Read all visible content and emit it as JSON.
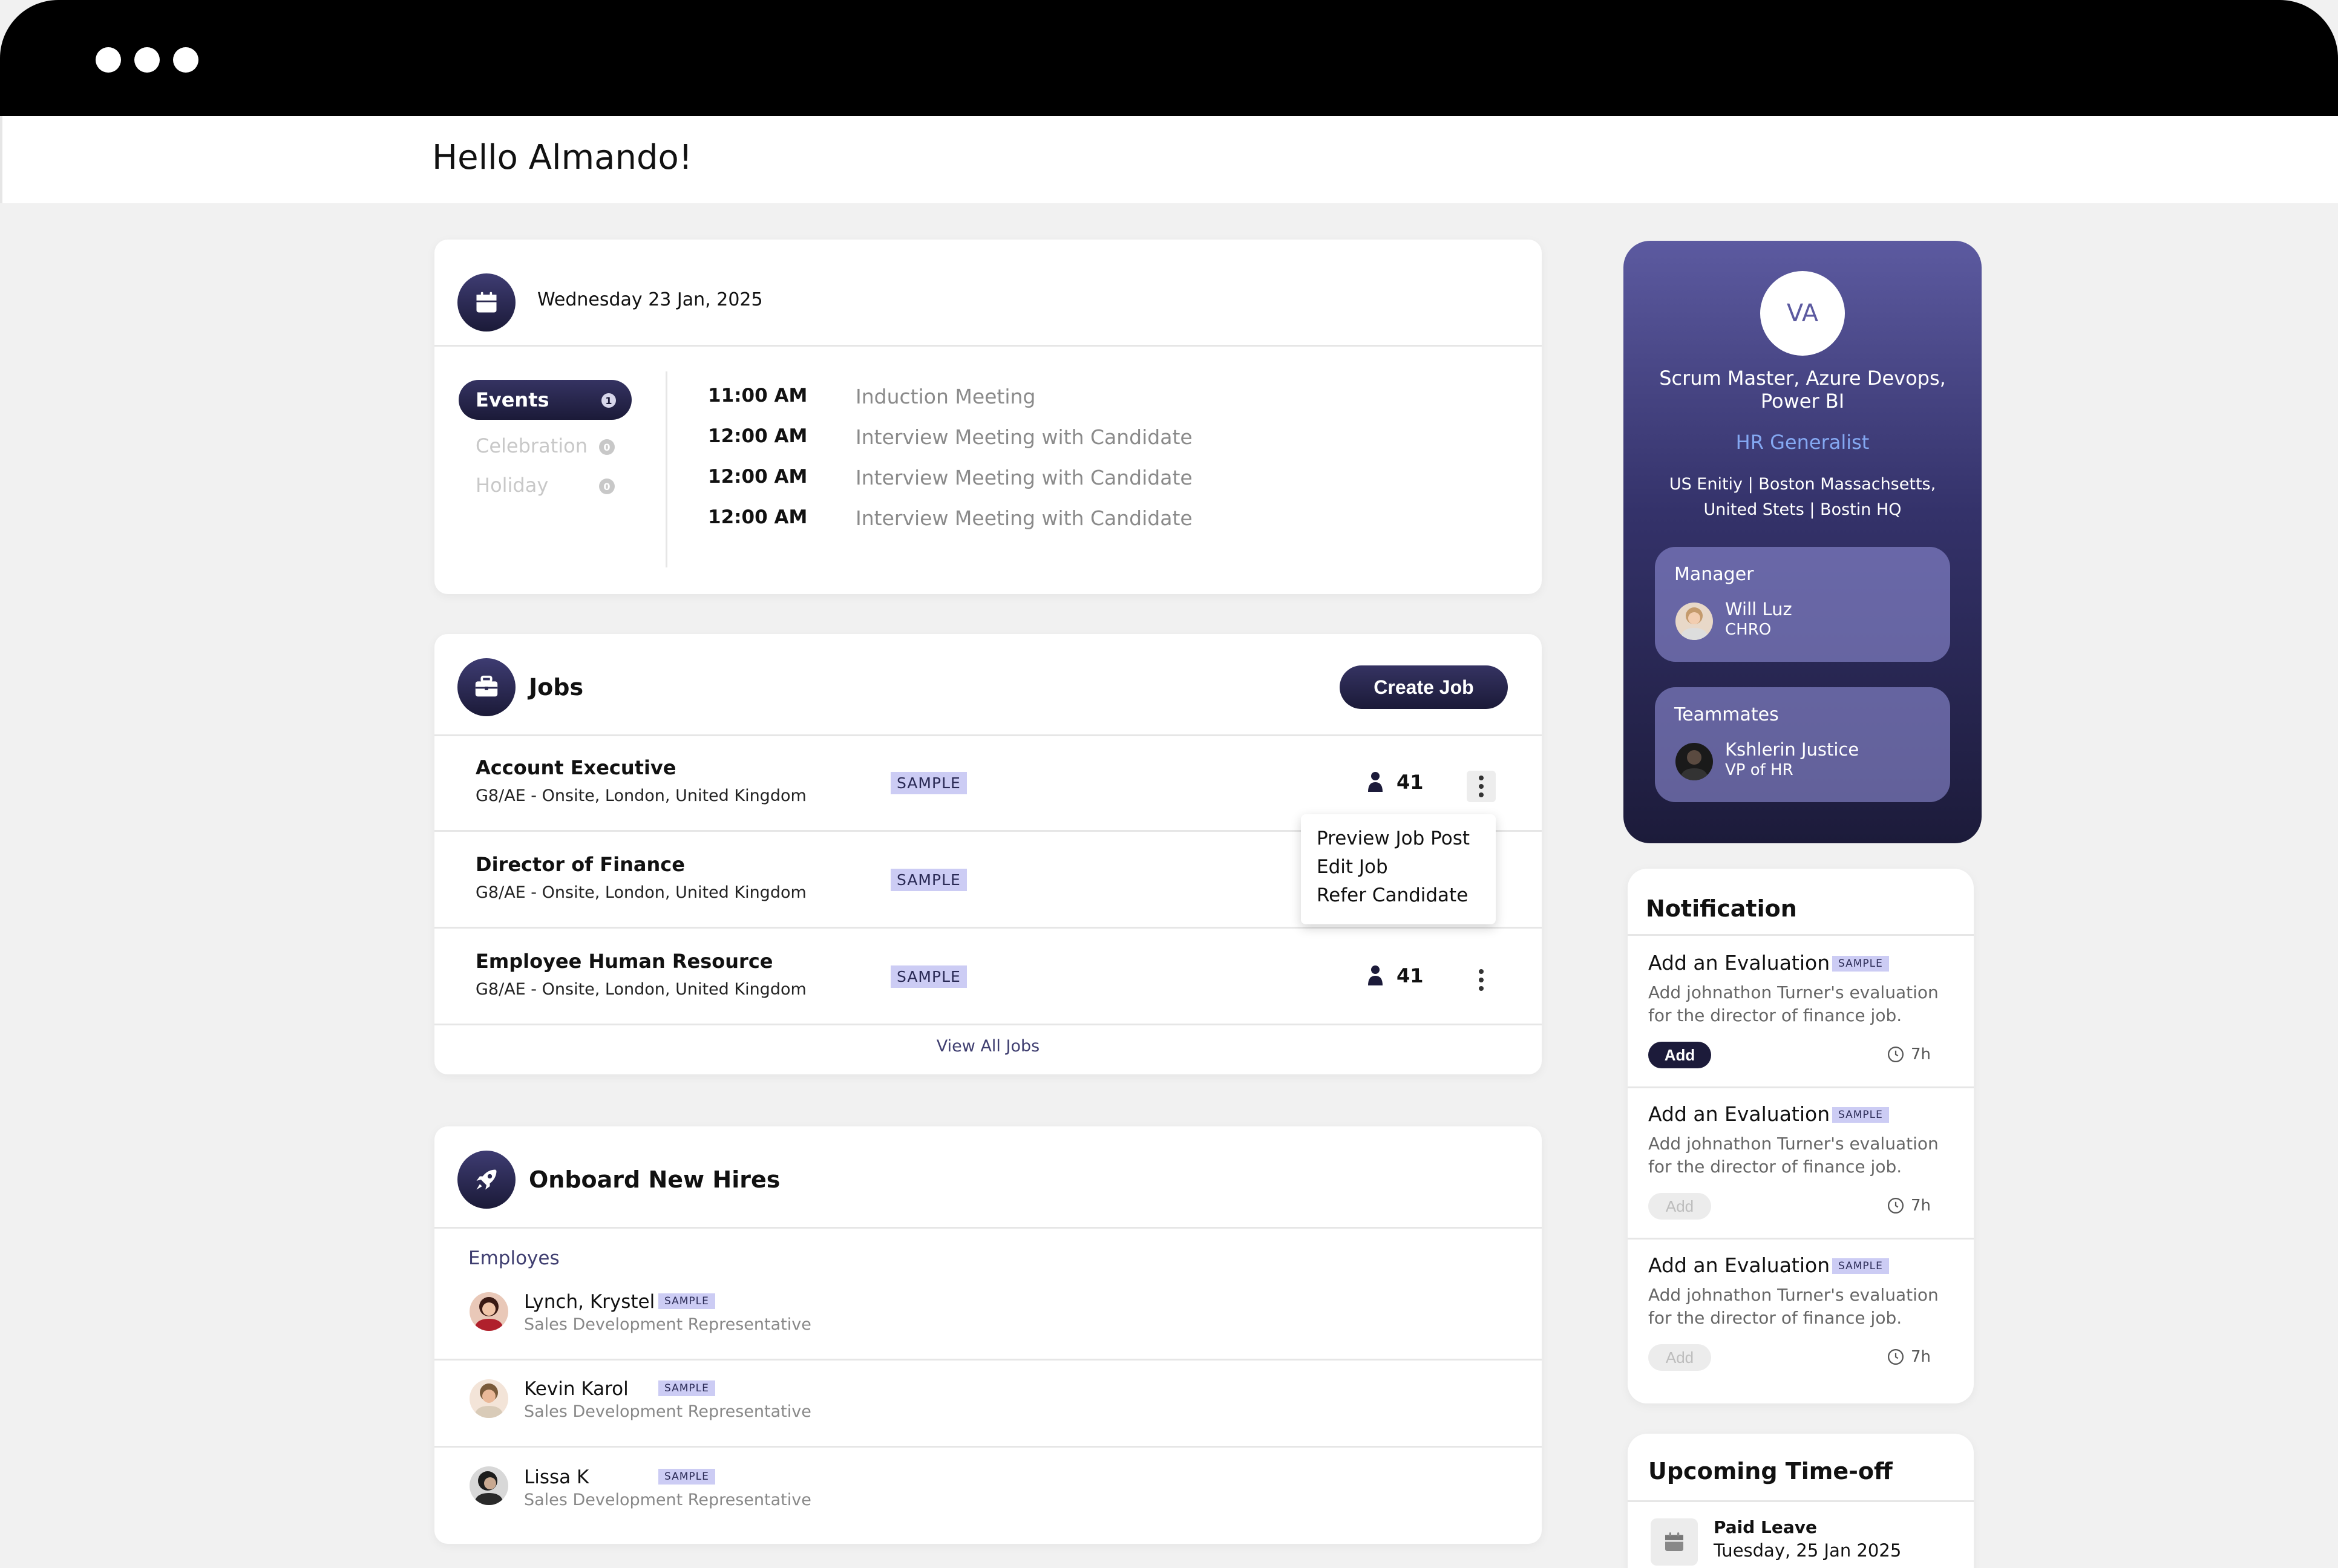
{
  "greeting": "Hello Almando!",
  "calendar": {
    "date": "Wednesday 23 Jan, 2025",
    "tabs": [
      {
        "label": "Events",
        "count": "1"
      },
      {
        "label": "Celebration",
        "count": "0"
      },
      {
        "label": "Holiday",
        "count": "0"
      }
    ],
    "events": [
      {
        "time": "11:00 AM",
        "title": "Induction Meeting"
      },
      {
        "time": "12:00 AM",
        "title": "Interview Meeting with Candidate"
      },
      {
        "time": "12:00 AM",
        "title": "Interview Meeting with Candidate"
      },
      {
        "time": "12:00 AM",
        "title": "Interview Meeting with Candidate"
      }
    ]
  },
  "jobs": {
    "title": "Jobs",
    "create_label": "Create Job",
    "items": [
      {
        "title": "Account Executive",
        "sub": "G8/AE - Onsite, London, United Kingdom",
        "tag": "SAMPLE",
        "count": "41"
      },
      {
        "title": "Director of Finance",
        "sub": "G8/AE - Onsite, London, United Kingdom",
        "tag": "SAMPLE",
        "count": ""
      },
      {
        "title": "Employee Human Resource",
        "sub": "G8/AE - Onsite, London, United Kingdom",
        "tag": "SAMPLE",
        "count": "41"
      }
    ],
    "view_all": "View All Jobs",
    "menu": [
      "Preview Job Post",
      "Edit Job",
      "Refer Candidate"
    ]
  },
  "onboard": {
    "title": "Onboard New Hires",
    "section": "Employes",
    "items": [
      {
        "name": "Lynch, Krystel",
        "role": "Sales Development Representative",
        "tag": "SAMPLE"
      },
      {
        "name": "Kevin Karol",
        "role": "Sales Development Representative",
        "tag": "SAMPLE"
      },
      {
        "name": "Lissa K",
        "role": "Sales Development Representative",
        "tag": "SAMPLE"
      }
    ]
  },
  "profile": {
    "initials": "VA",
    "role": "Scrum Master, Azure Devops, Power BI",
    "department": "HR Generalist",
    "location": "US Enitiy | Boston Massachsetts, United Stets | Bostin HQ",
    "manager": {
      "label": "Manager",
      "name": "Will Luz",
      "title": "CHRO"
    },
    "teammates": {
      "label": "Teammates",
      "name": "Kshlerin Justice",
      "title": "VP of HR"
    }
  },
  "notifications": {
    "title": "Notification",
    "items": [
      {
        "title": "Add an Evaluation",
        "tag": "SAMPLE",
        "desc": "Add johnathon Turner's evaluation for the director of finance job.",
        "action": "Add",
        "time": "7h"
      },
      {
        "title": "Add an Evaluation",
        "tag": "SAMPLE",
        "desc": "Add johnathon Turner's evaluation for the director of finance job.",
        "action": "Add",
        "time": "7h"
      },
      {
        "title": "Add an Evaluation",
        "tag": "SAMPLE",
        "desc": "Add johnathon Turner's evaluation for the director of finance job.",
        "action": "Add",
        "time": "7h"
      }
    ]
  },
  "timeoff": {
    "title": "Upcoming Time-off",
    "type": "Paid Leave",
    "date": "Tuesday, 25 Jan 2025"
  },
  "colors": {
    "brand_dark": "#1b1a38",
    "brand_purple": "#5c5aa0",
    "accent_link": "#84a8f2",
    "tag_bg": "#ccccf4"
  }
}
